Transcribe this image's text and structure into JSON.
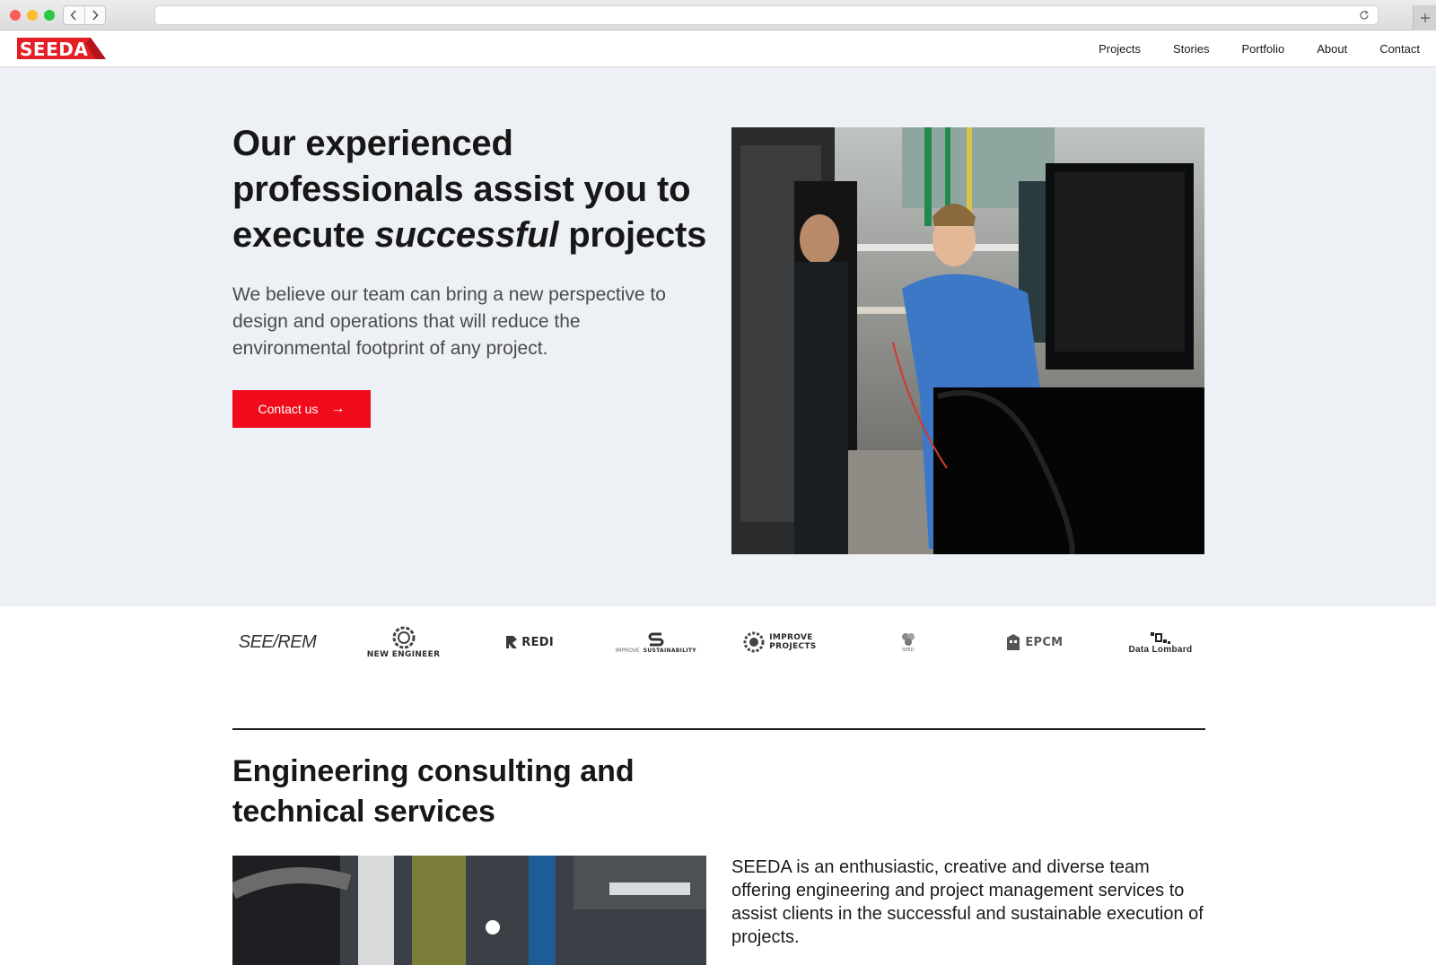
{
  "browser": {
    "back_icon": "chevron-left-icon",
    "forward_icon": "chevron-right-icon",
    "reload_icon": "reload-icon",
    "new_tab_icon": "plus-icon"
  },
  "header": {
    "logo_text": "SEEDA",
    "nav": [
      "Projects",
      "Stories",
      "Portfolio",
      "About",
      "Contact"
    ],
    "brand_color": "#e31e24"
  },
  "hero": {
    "title_part1": "Our experienced professionals assist you to execute ",
    "title_emphasis": "successful",
    "title_part2": " projects",
    "subtitle": "We believe our team can bring a new perspective to design and operations that will reduce the environmental footprint of any project.",
    "cta_label": "Contact us",
    "cta_icon": "arrow-right-icon",
    "cta_color": "#ef0b1b",
    "background": "#edf0f5"
  },
  "partners": [
    {
      "name": "SEE/REM"
    },
    {
      "name": "NEW ENGINEER"
    },
    {
      "name": "REDI"
    },
    {
      "name": "SUSTAINABILITY",
      "prefix": "IMPROVE"
    },
    {
      "name": "IMPROVE PROJECTS"
    },
    {
      "name": "SEED"
    },
    {
      "name": "EPCM"
    },
    {
      "name": "Data Lombard"
    }
  ],
  "section": {
    "title": "Engineering consulting and technical services",
    "body": "SEEDA is an enthusiastic, creative and diverse team offering engineering and project management services to assist clients in the successful and sustainable execution of projects."
  }
}
